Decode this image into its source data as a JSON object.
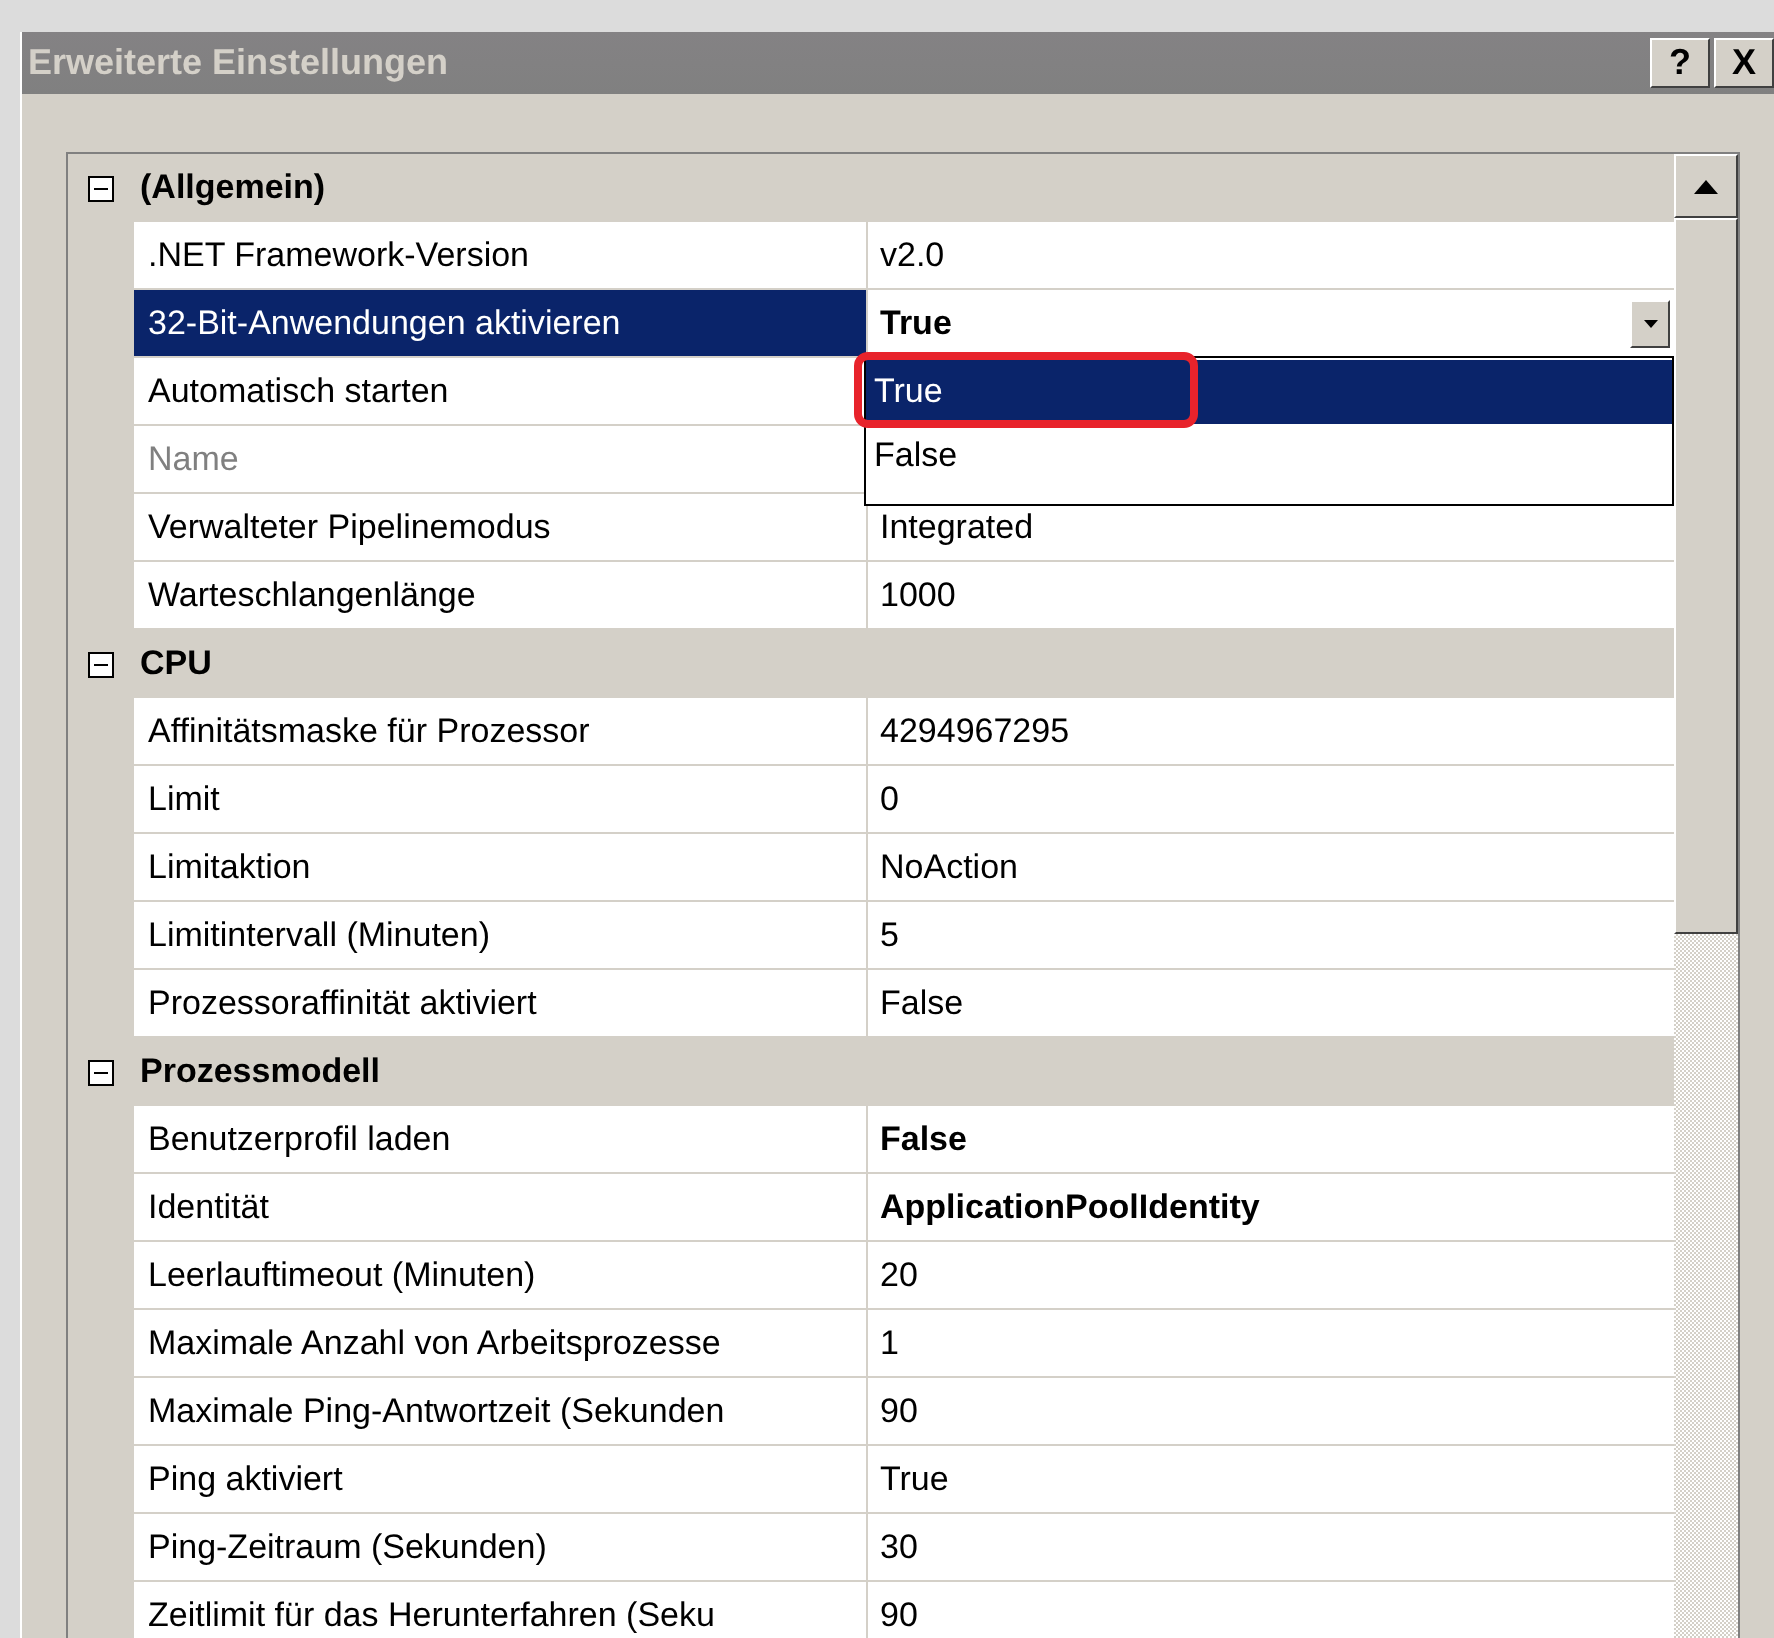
{
  "window": {
    "title": "Erweiterte Einstellungen",
    "buttons": [
      "?",
      "X"
    ]
  },
  "categories": [
    {
      "name": "(Allgemein)",
      "expanded": true,
      "properties": [
        {
          "name": ".NET Framework-Version",
          "value": "v2.0",
          "disabled": false,
          "selected": false
        },
        {
          "name": "32-Bit-Anwendungen aktivieren",
          "value": "True",
          "bold": true,
          "disabled": false,
          "selected": true,
          "dropdown": {
            "options": [
              {
                "label": "True",
                "selected": true,
                "highlighted": true
              },
              {
                "label": "False",
                "selected": false,
                "highlighted": false
              }
            ]
          }
        },
        {
          "name": "Automatisch starten",
          "disabled": false,
          "selected": false
        },
        {
          "name": "Name",
          "disabled": true,
          "selected": false
        },
        {
          "name": "Verwalteter Pipelinemodus",
          "value": "Integrated",
          "disabled": false,
          "selected": false
        },
        {
          "name": "Warteschlangenlänge",
          "value": "1000",
          "disabled": false,
          "selected": false
        }
      ]
    },
    {
      "name": "CPU",
      "expanded": true,
      "properties": [
        {
          "name": "Affinitätsmaske für Prozessor",
          "value": "4294967295",
          "disabled": false,
          "selected": false
        },
        {
          "name": "Limit",
          "value": "0",
          "disabled": false,
          "selected": false
        },
        {
          "name": "Limitaktion",
          "value": "NoAction",
          "disabled": false,
          "selected": false
        },
        {
          "name": "Limitintervall (Minuten)",
          "value": "5",
          "disabled": false,
          "selected": false
        },
        {
          "name": "Prozessoraffinität aktiviert",
          "value": "False",
          "disabled": false,
          "selected": false
        }
      ]
    },
    {
      "name": "Prozessmodell",
      "expanded": true,
      "properties": [
        {
          "name": "Benutzerprofil laden",
          "value": "False",
          "bold": true,
          "disabled": false,
          "selected": false
        },
        {
          "name": "Identität",
          "value": "ApplicationPoolIdentity",
          "bold": true,
          "disabled": false,
          "selected": false
        },
        {
          "name": "Leerlauftimeout (Minuten)",
          "value": "20",
          "disabled": false,
          "selected": false
        },
        {
          "name": "Maximale Anzahl von Arbeitsprozesse",
          "value": "1",
          "disabled": false,
          "selected": false
        },
        {
          "name": "Maximale Ping-Antwortzeit (Sekunden",
          "value": "90",
          "disabled": false,
          "selected": false
        },
        {
          "name": "Ping aktiviert",
          "value": "True",
          "disabled": false,
          "selected": false
        },
        {
          "name": "Ping-Zeitraum (Sekunden)",
          "value": "30",
          "disabled": false,
          "selected": false
        },
        {
          "name": "Zeitlimit für das Herunterfahren (Seku",
          "value": "90",
          "disabled": false,
          "selected": false
        }
      ]
    }
  ]
}
